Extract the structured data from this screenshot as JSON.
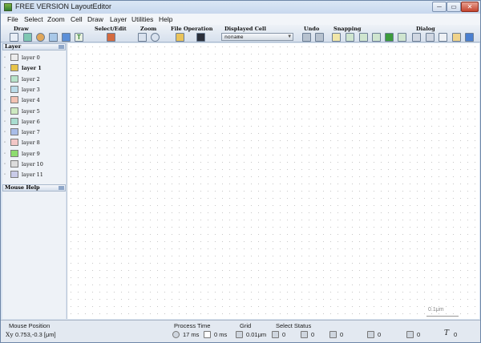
{
  "window": {
    "title": "FREE VERSION LayoutEditor",
    "controls": [
      "─",
      "▭",
      "✕"
    ]
  },
  "menu": [
    "File",
    "Select",
    "Zoom",
    "Cell",
    "Draw",
    "Layer",
    "Utilities",
    "Help"
  ],
  "toolbar": {
    "groups": {
      "draw": "Draw",
      "select_edit": "Select/Edit",
      "zoom": "Zoom",
      "file_operation": "File Operation",
      "displayed_cell": "Displayed Cell",
      "undo": "Undo",
      "snapping": "Snapping",
      "dialog": "Dialog"
    },
    "displayed_cell_value": "noname",
    "icons": {
      "draw": [
        "polygon-draw-icon",
        "box-draw-icon",
        "circle-draw-icon",
        "path-draw-icon",
        "cell-ref-icon",
        "text-draw-icon"
      ],
      "select_edit": [
        "select-edit-icon"
      ],
      "zoom": [
        "zoom-fit-icon",
        "zoom-magnify-icon"
      ],
      "file_operation": [
        "open-folder-icon",
        "save-disk-icon"
      ],
      "undo": [
        "undo-icon",
        "redo-icon"
      ],
      "snapping": [
        "snap-grid-icon",
        "snap-edge-icon",
        "snap-angle-icon",
        "snap-ortho-icon",
        "snap-point-icon",
        "snap-45-icon"
      ],
      "dialog": [
        "settings-icon",
        "properties-icon",
        "chat-icon",
        "notes-icon",
        "palette-icon"
      ]
    }
  },
  "layers": {
    "header": "Layer",
    "items": [
      {
        "label": "layer 0",
        "color": "#ececec",
        "bold": false
      },
      {
        "label": "layer 1",
        "color": "#e8c448",
        "bold": true
      },
      {
        "label": "layer 2",
        "color": "#b7e3c9",
        "bold": false
      },
      {
        "label": "layer 3",
        "color": "#b9dbe8",
        "bold": false
      },
      {
        "label": "layer 4",
        "color": "#f2c2b3",
        "bold": false
      },
      {
        "label": "layer 5",
        "color": "#cde9c0",
        "bold": false
      },
      {
        "label": "layer 6",
        "color": "#a9ddd0",
        "bold": false
      },
      {
        "label": "layer 7",
        "color": "#a9bde8",
        "bold": false
      },
      {
        "label": "layer 8",
        "color": "#f3c7c7",
        "bold": false
      },
      {
        "label": "layer 9",
        "color": "#8ddc6f",
        "bold": false
      },
      {
        "label": "layer 10",
        "color": "#dcdcdc",
        "bold": false
      },
      {
        "label": "layer 11",
        "color": "#c9cbe8",
        "bold": false
      }
    ]
  },
  "mouse_help": {
    "header": "Mouse Help"
  },
  "canvas": {
    "scale_label": "0.1μm"
  },
  "status": {
    "mouse_position": {
      "label": "Mouse Position",
      "value": "0.753,-0.3 [μm]"
    },
    "process_time": {
      "label": "Process Time",
      "value1": "17 ms",
      "value2": "0 ms"
    },
    "grid": {
      "label": "Grid",
      "value": "0.01μm"
    },
    "select_status": {
      "label": "Select Status",
      "counts": [
        "0",
        "0",
        "0",
        "0",
        "0",
        "0"
      ]
    }
  }
}
